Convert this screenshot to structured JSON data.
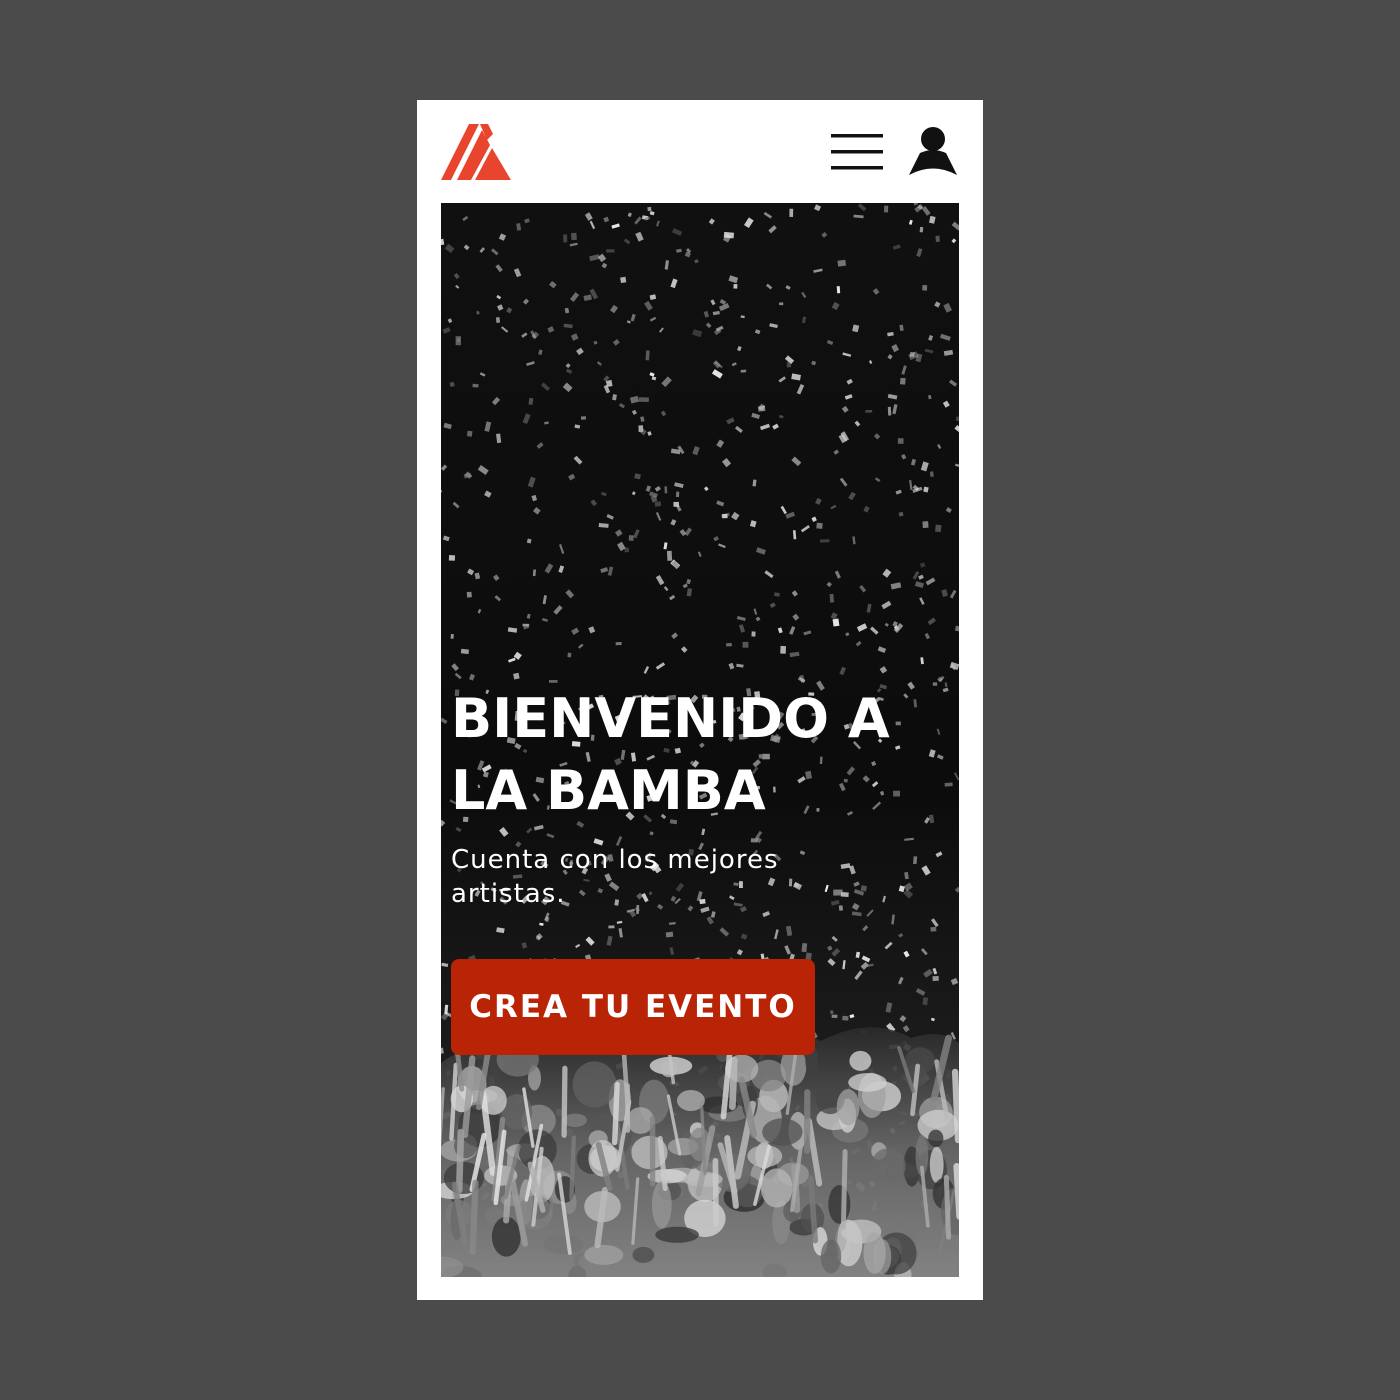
{
  "header": {
    "logo_icon": "la-bamba-logo-icon",
    "menu_icon": "hamburger-menu-icon",
    "user_icon": "user-account-icon"
  },
  "hero": {
    "background_image": "concert-crowd-confetti-photo",
    "title": "BIENVENIDO A LA BAMBA",
    "subtitle": "Cuenta con los mejores artistas.",
    "cta_label": "CREA TU EVENTO"
  },
  "colors": {
    "page_background": "#4b4b4b",
    "brand_red": "#e8442e",
    "cta_background": "#b82405",
    "cta_text": "#ffffff"
  }
}
